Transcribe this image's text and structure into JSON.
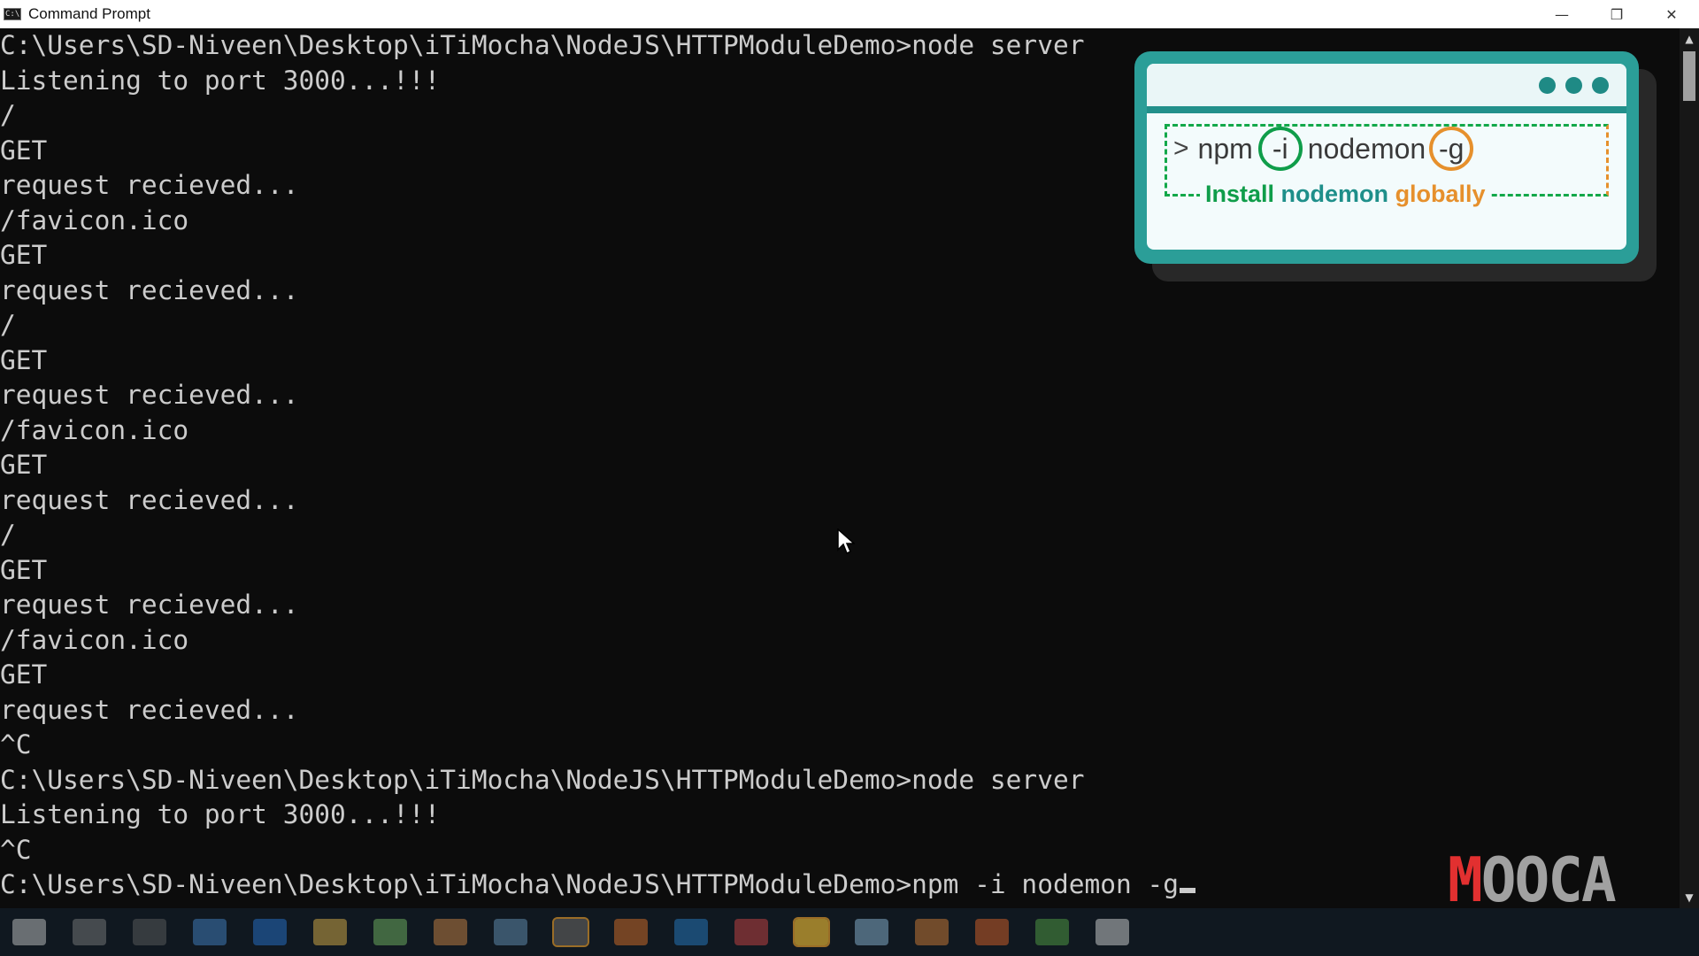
{
  "window": {
    "title": "Command Prompt",
    "icon_label": "C:\\",
    "controls": {
      "minimize": "—",
      "restore": "❐",
      "close": "✕"
    }
  },
  "console": {
    "lines": [
      "C:\\Users\\SD-Niveen\\Desktop\\iTiMocha\\NodeJS\\HTTPModuleDemo>node server",
      "Listening to port 3000...!!!",
      "/",
      "GET",
      "request recieved...",
      "/favicon.ico",
      "GET",
      "request recieved...",
      "/",
      "GET",
      "request recieved...",
      "/favicon.ico",
      "GET",
      "request recieved...",
      "/",
      "GET",
      "request recieved...",
      "/favicon.ico",
      "GET",
      "request recieved...",
      "^C",
      "C:\\Users\\SD-Niveen\\Desktop\\iTiMocha\\NodeJS\\HTTPModuleDemo>node server",
      "Listening to port 3000...!!!",
      "^C"
    ],
    "current_prompt": "C:\\Users\\SD-Niveen\\Desktop\\iTiMocha\\NodeJS\\HTTPModuleDemo>npm -i nodemon -g"
  },
  "overlay": {
    "prompt_symbol": ">",
    "cmd_npm": "npm",
    "cmd_flag_i": "-i",
    "cmd_pkg": "nodemon",
    "cmd_flag_g": "-g",
    "caption_install": "Install",
    "caption_nodemon": "nodemon",
    "caption_globally": "globally"
  },
  "watermark": {
    "first": "M",
    "rest": "OOCA"
  },
  "colors": {
    "console_bg": "#0c0c0c",
    "console_text": "#cccccc",
    "overlay_teal": "#2b9e98",
    "overlay_green": "#0f9d4a",
    "overlay_orange": "#e6902c",
    "watermark_red": "#e23030"
  },
  "taskbar": {
    "icons": [
      "start-icon",
      "search-icon",
      "task-view-icon",
      "chrome-icon",
      "edge-icon",
      "file-explorer-icon",
      "excel-icon",
      "app-icon",
      "app-icon",
      "terminal-icon",
      "firefox-icon",
      "vscode-icon",
      "app-icon",
      "app-icon",
      "app-icon",
      "app-icon",
      "app-icon",
      "chrome-icon",
      "mail-icon"
    ]
  }
}
